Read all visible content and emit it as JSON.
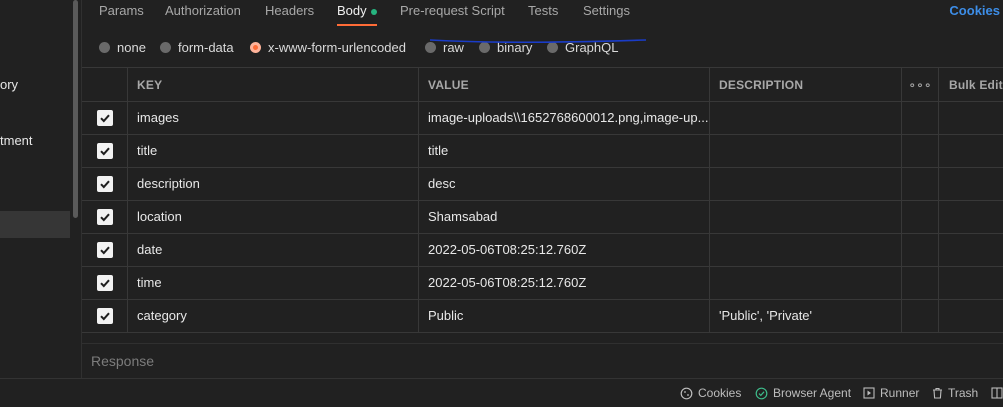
{
  "sidebar": {
    "items": [
      {
        "label": "ory"
      },
      {
        "label": "tment"
      }
    ]
  },
  "tabs": [
    {
      "label": "Params",
      "active": false
    },
    {
      "label": "Authorization",
      "active": false
    },
    {
      "label": "Headers",
      "active": false
    },
    {
      "label": "Body",
      "active": true
    },
    {
      "label": "Pre-request Script",
      "active": false
    },
    {
      "label": "Tests",
      "active": false
    },
    {
      "label": "Settings",
      "active": false
    }
  ],
  "cookies_link": "Cookies",
  "body_types": [
    {
      "label": "none",
      "selected": false
    },
    {
      "label": "form-data",
      "selected": false
    },
    {
      "label": "x-www-form-urlencoded",
      "selected": true
    },
    {
      "label": "raw",
      "selected": false
    },
    {
      "label": "binary",
      "selected": false
    },
    {
      "label": "GraphQL",
      "selected": false
    }
  ],
  "table": {
    "headers": {
      "key": "KEY",
      "value": "VALUE",
      "description": "DESCRIPTION",
      "more": "∘∘∘",
      "bulk_edit": "Bulk Edit"
    },
    "rows": [
      {
        "checked": true,
        "key": "images",
        "value": "image-uploads\\\\1652768600012.png,image-up...",
        "description": ""
      },
      {
        "checked": true,
        "key": "title",
        "value": "title",
        "description": ""
      },
      {
        "checked": true,
        "key": "description",
        "value": "desc",
        "description": ""
      },
      {
        "checked": true,
        "key": "location",
        "value": "Shamsabad",
        "description": ""
      },
      {
        "checked": true,
        "key": "date",
        "value": "2022-05-06T08:25:12.760Z",
        "description": ""
      },
      {
        "checked": true,
        "key": "time",
        "value": "2022-05-06T08:25:12.760Z",
        "description": ""
      },
      {
        "checked": true,
        "key": "category",
        "value": "Public",
        "description": "'Public', 'Private'"
      }
    ]
  },
  "response_label": "Response",
  "statusbar": {
    "cookies": "Cookies",
    "browser_agent": "Browser Agent",
    "runner": "Runner",
    "trash": "Trash"
  },
  "colors": {
    "accent": "#ff6c37",
    "link": "#3d8ee8",
    "status_dot": "#26b47f",
    "annotation": "#1a3cc8"
  }
}
